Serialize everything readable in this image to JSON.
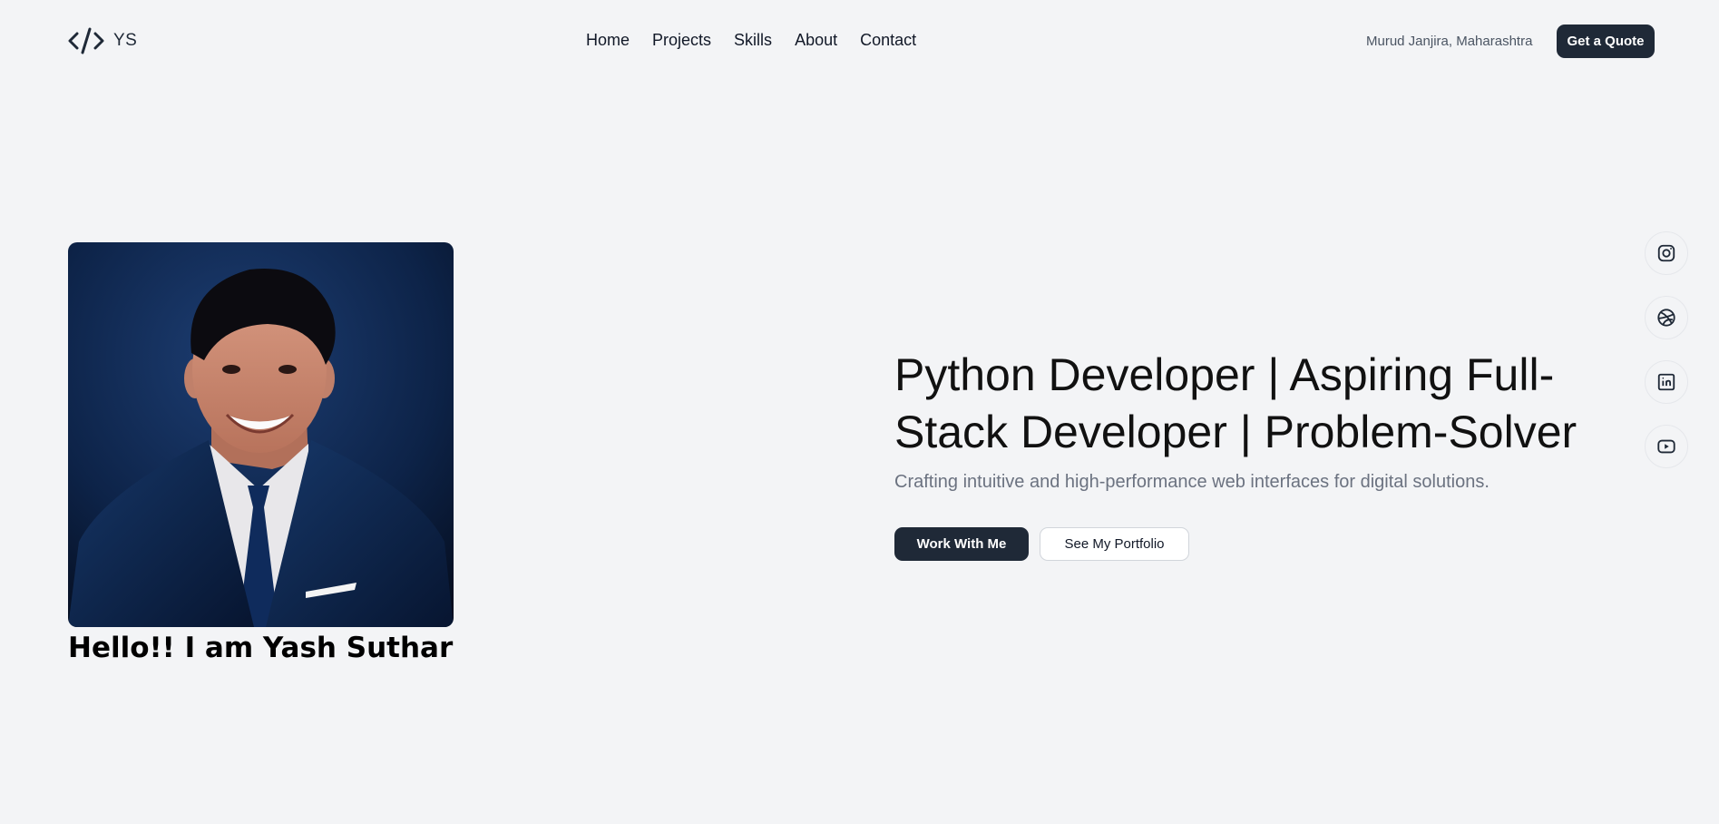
{
  "header": {
    "logo_text": "YS",
    "nav": [
      "Home",
      "Projects",
      "Skills",
      "About",
      "Contact"
    ],
    "location": "Murud Janjira, Maharashtra",
    "quote_button": "Get a Quote"
  },
  "profile": {
    "greeting": "Hello!! I am Yash Suthar"
  },
  "hero": {
    "title": "Python Developer | Aspiring Full-Stack Developer | Problem-Solver",
    "subtitle": "Crafting intuitive and high-performance web interfaces for digital solutions.",
    "primary_button": "Work With Me",
    "secondary_button": "See My Portfolio"
  },
  "social": {
    "icons": [
      "instagram-icon",
      "dribbble-icon",
      "linkedin-icon",
      "youtube-icon"
    ]
  },
  "colors": {
    "background": "#f3f4f6",
    "primary_button": "#1f2937",
    "text": "#111827",
    "muted_text": "#6b7280"
  }
}
